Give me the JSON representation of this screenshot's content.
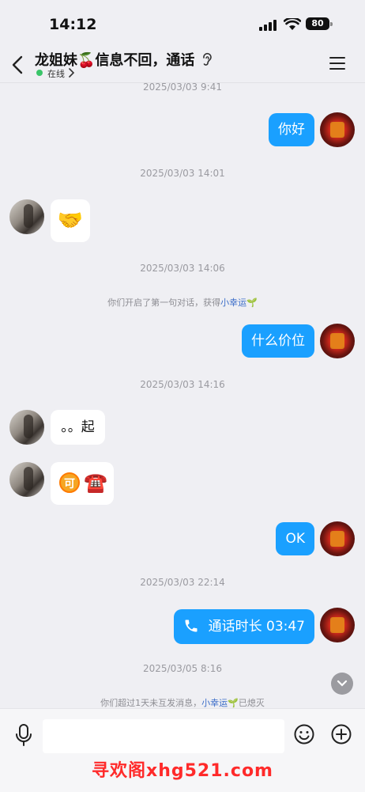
{
  "status_bar": {
    "time": "14:12",
    "battery": "80"
  },
  "header": {
    "title": "龙姐妹🍒信息不回，通话",
    "online_status": "在线"
  },
  "messages": {
    "ts1": "2025/03/03 9:41",
    "m1": "你好",
    "ts2": "2025/03/03 14:01",
    "m2": "🤝",
    "ts3": "2025/03/03 14:06",
    "sys1_prefix": "你们开启了第一句对话，获得",
    "sys1_highlight": "小幸运",
    "sys1_emoji": "🌱",
    "m3": "什么价位",
    "ts4": "2025/03/03 14:16",
    "m4": "。。起",
    "m5_badge": "可",
    "m5_emoji": "☎️",
    "m6": "OK",
    "ts5": "2025/03/03 22:14",
    "call_label": "通话时长 03:47",
    "ts6": "2025/03/05 8:16",
    "sys2_prefix": "你们超过1天未互发消息，",
    "sys2_highlight": "小幸运",
    "sys2_emoji": "🌱",
    "sys2_suffix": "已熄灭"
  },
  "watermark": "寻欢阁xhg521.com",
  "colors": {
    "accent": "#1aa0ff",
    "online": "#3ac569",
    "link": "#3a6cc8",
    "watermark": "#ff2a2a"
  },
  "icons": [
    "back-icon",
    "ear-icon",
    "menu-icon",
    "mic-icon",
    "emoji-icon",
    "plus-icon",
    "phone-icon",
    "chevron-down-icon",
    "wifi-icon",
    "signal-icon"
  ]
}
